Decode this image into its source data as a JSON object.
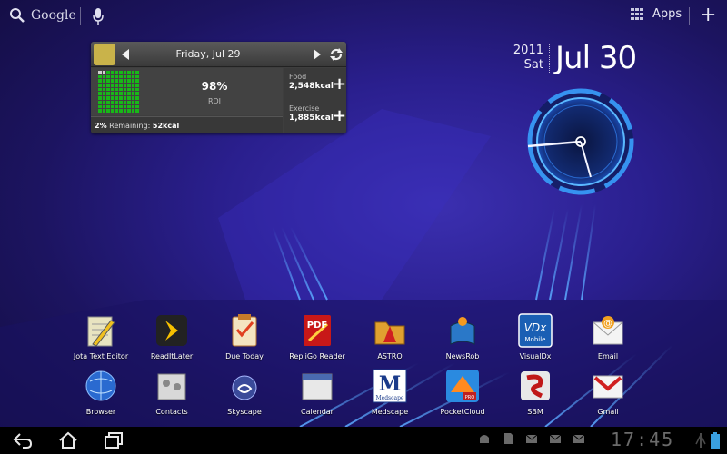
{
  "top_bar": {
    "search_label": "Google",
    "apps_label": "Apps",
    "add_label": "+"
  },
  "calorie_widget": {
    "date": "Friday, Jul 29",
    "percent": "98%",
    "rdi_label": "RDI",
    "remaining_pct": "2%",
    "remaining_text": "Remaining:",
    "remaining_kcal": "52kcal",
    "food_label": "Food",
    "food_value": "2,548kcal",
    "exercise_label": "Exercise",
    "exercise_value": "1,885kcal",
    "progress_fraction": 0.98
  },
  "date_widget": {
    "year": "2011",
    "day_of_week": "Sat",
    "date": "Jul 30"
  },
  "apps": [
    {
      "label": "Jota Text Editor",
      "icon": "jota-text-editor-icon"
    },
    {
      "label": "ReadItLater",
      "icon": "readitlater-icon"
    },
    {
      "label": "Due Today",
      "icon": "due-today-icon"
    },
    {
      "label": "RepliGo Reader",
      "icon": "repligo-reader-icon"
    },
    {
      "label": "ASTRO",
      "icon": "astro-icon"
    },
    {
      "label": "NewsRob",
      "icon": "newsrob-icon"
    },
    {
      "label": "VisualDx",
      "icon": "visualdx-icon"
    },
    {
      "label": "Email",
      "icon": "email-icon"
    },
    {
      "label": "Browser",
      "icon": "browser-icon"
    },
    {
      "label": "Contacts",
      "icon": "contacts-icon"
    },
    {
      "label": "Skyscape",
      "icon": "skyscape-icon"
    },
    {
      "label": "Calendar",
      "icon": "calendar-icon"
    },
    {
      "label": "Medscape",
      "icon": "medscape-icon"
    },
    {
      "label": "PocketCloud",
      "icon": "pocketcloud-icon"
    },
    {
      "label": "SBM",
      "icon": "sbm-icon"
    },
    {
      "label": "Gmail",
      "icon": "gmail-icon"
    }
  ],
  "icon_text": {
    "pdf": "PDF",
    "medscape_letter": "M",
    "medscape_word": "Medscape",
    "visualdx_logo": "VDx",
    "visualdx_sub": "Mobile",
    "pro": "PRO"
  },
  "status_bar": {
    "time": "17:45",
    "icons": [
      "android-icon",
      "sd-card-icon",
      "email-notification-icon",
      "email-notification-icon",
      "email-notification-icon"
    ]
  },
  "colors": {
    "background": "#2a1f8e",
    "rdi_grid": "#18b818",
    "clock_ring": "#3aa0ff"
  }
}
